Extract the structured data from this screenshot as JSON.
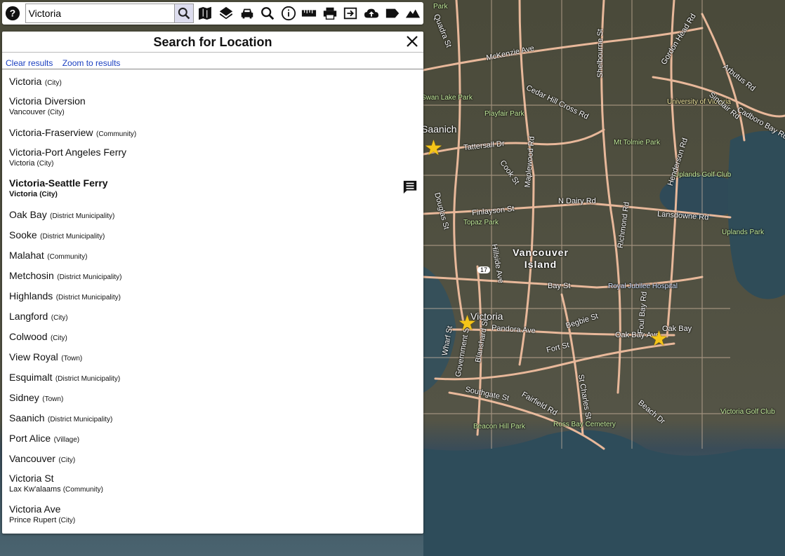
{
  "toolbar": {
    "search_value": "Victoria",
    "icons": [
      "help-icon",
      "search-icon",
      "map-icon",
      "layers-icon",
      "car-icon",
      "find-icon",
      "info-icon",
      "measure-icon",
      "print-icon",
      "export-icon",
      "upload-icon",
      "label-icon",
      "terrain-icon"
    ]
  },
  "panel": {
    "title": "Search for Location",
    "clear_label": "Clear results",
    "zoom_label": "Zoom to results",
    "results": [
      {
        "name": "Victoria",
        "type": "(City)"
      },
      {
        "name": "Victoria Diversion",
        "sub_name": "Vancouver",
        "sub_type": "(City)"
      },
      {
        "name": "Victoria-Fraserview",
        "type": "(Community)"
      },
      {
        "name": "Victoria-Port Angeles Ferry",
        "sub_name": "Victoria",
        "sub_type": "(City)"
      },
      {
        "name": "Victoria-Seattle Ferry",
        "sub_name": "Victoria",
        "sub_type": "(City)"
      },
      {
        "name": "Oak Bay",
        "type": "(District Municipality)"
      },
      {
        "name": "Sooke",
        "type": "(District Municipality)"
      },
      {
        "name": "Malahat",
        "type": "(Community)"
      },
      {
        "name": "Metchosin",
        "type": "(District Municipality)"
      },
      {
        "name": "Highlands",
        "type": "(District Municipality)"
      },
      {
        "name": "Langford",
        "type": "(City)"
      },
      {
        "name": "Colwood",
        "type": "(City)"
      },
      {
        "name": "View Royal",
        "type": "(Town)"
      },
      {
        "name": "Esquimalt",
        "type": "(District Municipality)"
      },
      {
        "name": "Sidney",
        "type": "(Town)"
      },
      {
        "name": "Saanich",
        "type": "(District Municipality)"
      },
      {
        "name": "Port Alice",
        "type": "(Village)"
      },
      {
        "name": "Vancouver",
        "type": "(City)"
      },
      {
        "name": "Victoria St",
        "sub_name": "Lax Kw'alaams",
        "sub_type": "(Community)"
      },
      {
        "name": "Victoria Ave",
        "sub_name": "Prince Rupert",
        "sub_type": "(City)"
      }
    ]
  },
  "map": {
    "labels": {
      "park": "Park",
      "mckenzie": "McKenzie Ave",
      "quadra": "Quadra St",
      "shelbourne": "Shelbourne St",
      "gordon_head": "Gordon Head Rd",
      "arbutus": "Arbutus Rd",
      "swan_lake": "Swan Lake Park",
      "cedar_hill": "Cedar Hill Cross Rd",
      "uvic": "University of Victoria",
      "sinclair": "Sinclair Rd",
      "cadboro": "Cadboro Bay Rd",
      "saanich": "Saanich",
      "playfair": "Playfair Park",
      "tattersall": "Tattersall Dr",
      "mt_tolmie": "Mt Tolmie Park",
      "uplands_golf": "Uplands Golf Club",
      "cook": "Cook St",
      "maplewood": "Maplewood Rd",
      "henderson": "Henderson Rd",
      "finlayson": "Finlayson St",
      "n_dairy": "N Dairy Rd",
      "lansdowne": "Lansdowne Rd",
      "douglas": "Douglas St",
      "topaz": "Topaz Park",
      "richmond": "Richmond Rd",
      "uplands_park": "Uplands Park",
      "hillside": "Hillside Ave",
      "vancouver_island": "Vancouver Island",
      "bay_st": "Bay St",
      "royal_jubilee": "Royal Jubilee Hospital",
      "victoria": "Victoria",
      "pandora": "Pandora Ave",
      "begbie": "Begbie St",
      "oak_bay_ave": "Oak Bay Ave",
      "oak_bay": "Oak Bay",
      "wharf": "Wharf St",
      "government": "Government St",
      "blanshard": "Blanshard St",
      "fort": "Fort St",
      "foul_bay": "Foul Bay Rd",
      "southgate": "Southgate St",
      "fairfield": "Fairfield Rd",
      "st_charles": "St Charles St",
      "beach": "Beach Dr",
      "beacon_hill": "Beacon Hill Park",
      "ross_bay": "Ross Bay Cemetery",
      "victoria_golf": "Victoria Golf Club",
      "hwy17": "17"
    }
  }
}
